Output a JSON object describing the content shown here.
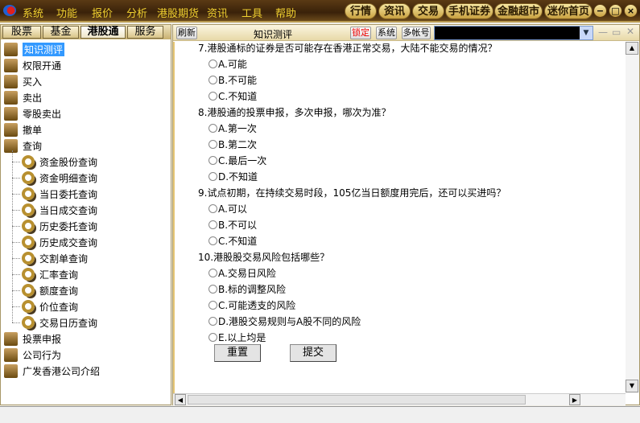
{
  "menubar": {
    "items": [
      "系统",
      "功能",
      "报价",
      "分析",
      "港股期货",
      "资讯",
      "工具",
      "帮助"
    ],
    "pills": [
      "行情",
      "资讯",
      "交易",
      "手机证券",
      "金融超市",
      "迷你首页"
    ]
  },
  "left": {
    "tabs": [
      "股票",
      "基金",
      "港股通",
      "服务"
    ],
    "active_tab": "港股通",
    "items": [
      "知识测评",
      "权限开通",
      "买入",
      "卖出",
      "零股卖出",
      "撤单",
      "查询"
    ],
    "sub_items": [
      "资金股份查询",
      "资金明细查询",
      "当日委托查询",
      "当日成交查询",
      "历史委托查询",
      "历史成交查询",
      "交割单查询",
      "汇率查询",
      "额度查询",
      "价位查询",
      "交易日历查询"
    ],
    "bottom_items": [
      "投票申报",
      "公司行为",
      "广发香港公司介绍"
    ],
    "selected": "知识测评"
  },
  "toolbar": {
    "refresh": "刷新",
    "title": "知识测评",
    "lock": "锁定",
    "system": "系统",
    "multi_account": "多帐号"
  },
  "questions": [
    {
      "text": "7.港股通标的证券是否可能存在香港正常交易，大陆不能交易的情况？",
      "options": [
        "A.可能",
        "B.不可能",
        "C.不知道"
      ]
    },
    {
      "text": "8.港股通的投票申报，多次申报，哪次为准？",
      "options": [
        "A.第一次",
        "B.第二次",
        "C.最后一次",
        "D.不知道"
      ]
    },
    {
      "text": "9.试点初期，在持续交易时段，105亿当日额度用完后，还可以买进吗？",
      "options": [
        "A.可以",
        "B.不可以",
        "C.不知道"
      ]
    },
    {
      "text": "10.港股股交易风险包括哪些？",
      "options": [
        "A.交易日风险",
        "B.标的调整风险",
        "C.可能透支的风险",
        "D.港股交易规则与A股不同的风险",
        "E.以上均是"
      ]
    }
  ],
  "buttons": {
    "reset": "重置",
    "submit": "提交"
  }
}
